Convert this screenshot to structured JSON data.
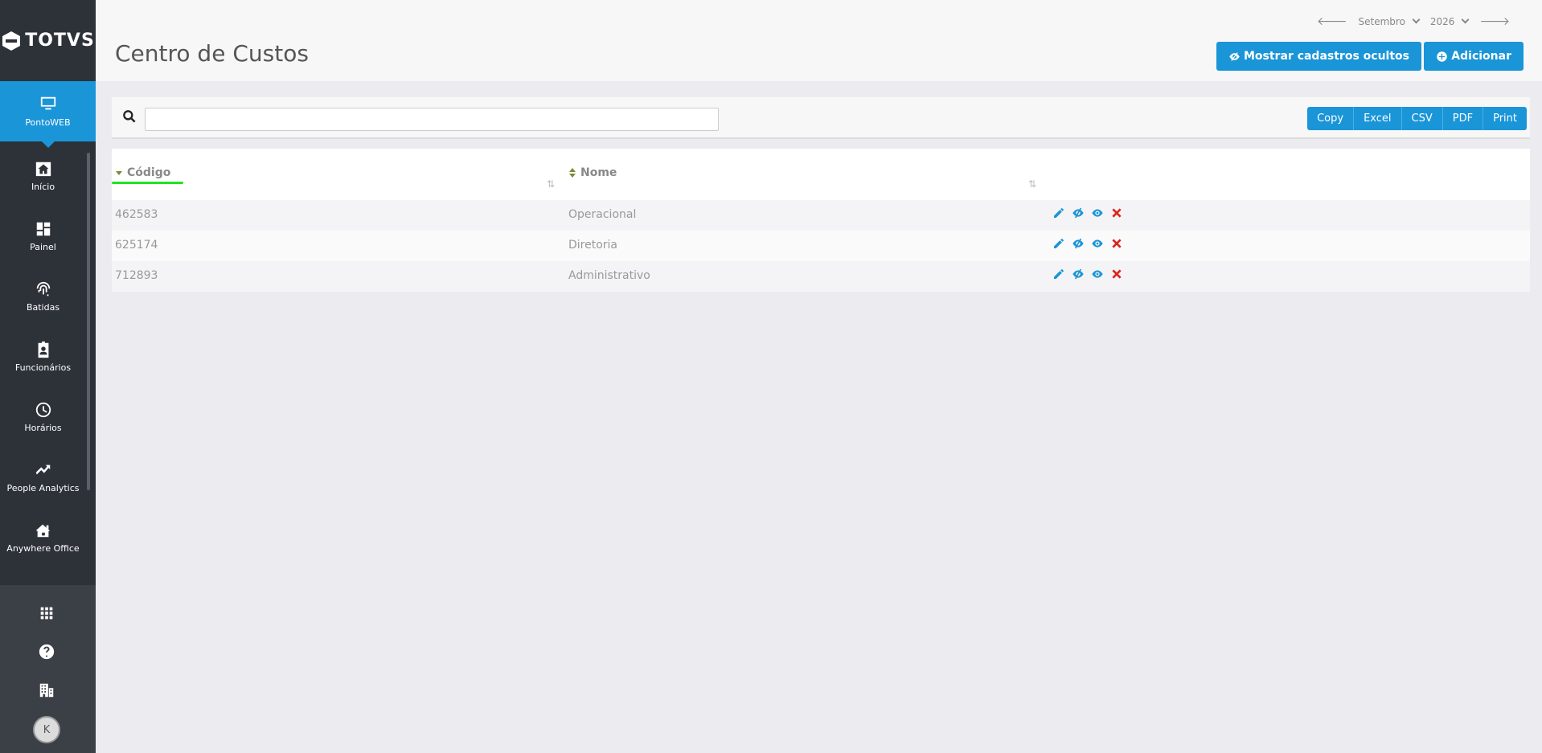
{
  "brand": {
    "logo_text": "TOTVS"
  },
  "sidebar": {
    "active": {
      "label": "PontoWEB",
      "icon": "monitor-icon"
    },
    "items": [
      {
        "label": "Início",
        "icon": "home-icon"
      },
      {
        "label": "Painel",
        "icon": "dashboard-icon"
      },
      {
        "label": "Batidas",
        "icon": "fingerprint-icon"
      },
      {
        "label": "Funcionários",
        "icon": "id-badge-icon"
      },
      {
        "label": "Horários",
        "icon": "clock-icon"
      },
      {
        "label": "People Analytics",
        "icon": "trend-icon"
      },
      {
        "label": "Anywhere Office",
        "icon": "home-office-icon"
      }
    ],
    "bottom": {
      "avatar_initial": "K"
    }
  },
  "header": {
    "title": "Centro de Custos",
    "month": "Setembro",
    "year": "2026",
    "show_hidden_label": "Mostrar cadastros ocultos",
    "add_label": "Adicionar"
  },
  "search": {
    "value": "",
    "placeholder": ""
  },
  "export_buttons": [
    "Copy",
    "Excel",
    "CSV",
    "PDF",
    "Print"
  ],
  "table": {
    "columns": [
      "Código",
      "Nome"
    ],
    "rows": [
      {
        "codigo": "462583",
        "nome": "Operacional"
      },
      {
        "codigo": "625174",
        "nome": "Diretoria"
      },
      {
        "codigo": "712893",
        "nome": "Administrativo"
      }
    ]
  },
  "colors": {
    "accent": "#1a95d8",
    "sidebar": "#2d3138",
    "delete": "#d9251c",
    "highlight": "#22e222"
  }
}
